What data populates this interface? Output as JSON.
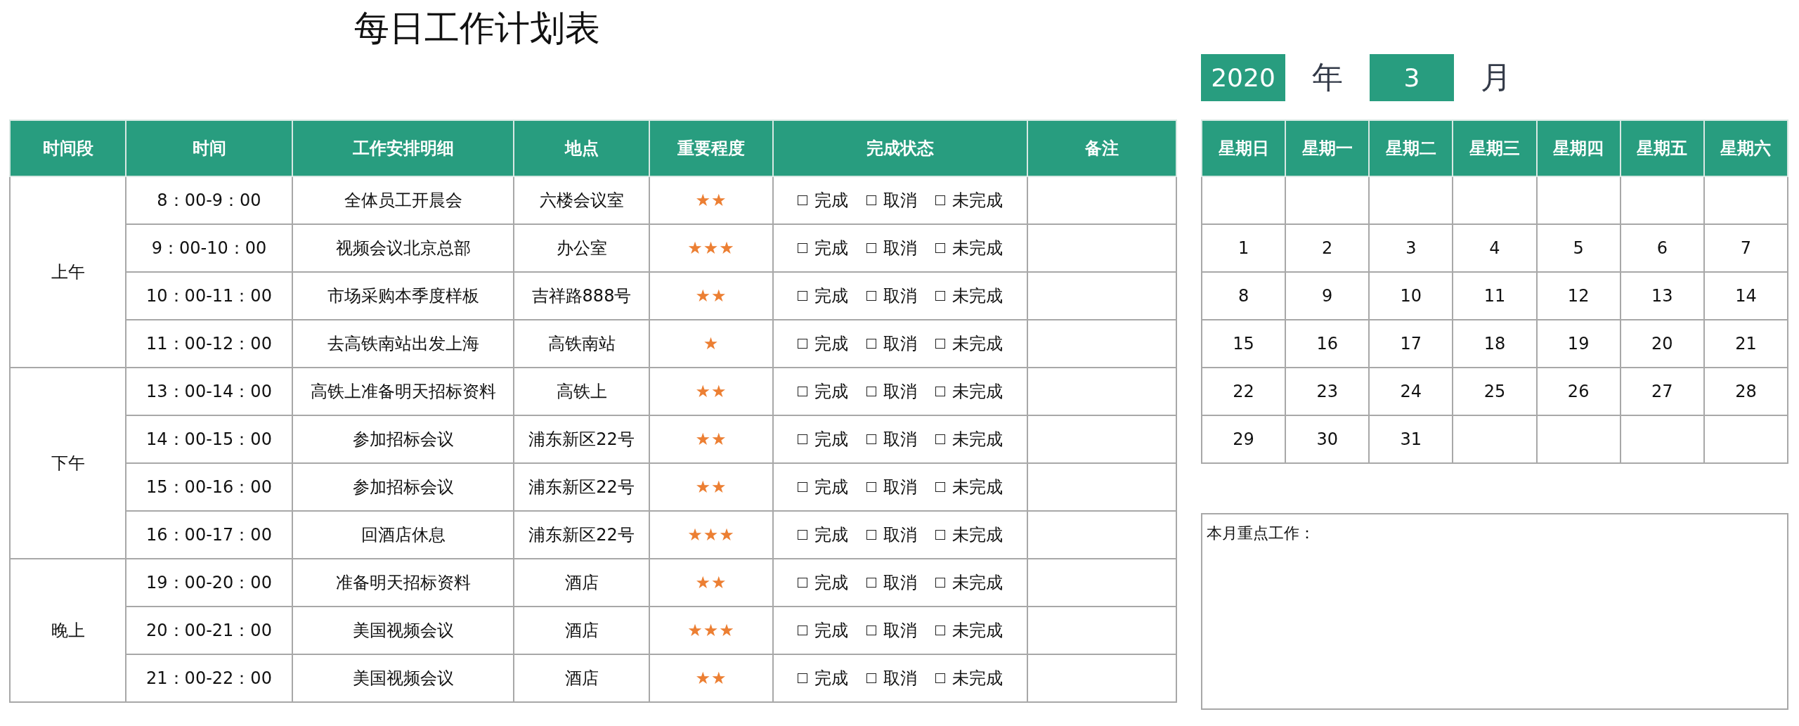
{
  "title": "每日工作计划表",
  "columns": [
    "时间段",
    "时间",
    "工作安排明细",
    "地点",
    "重要程度",
    "完成状态",
    "备注"
  ],
  "periods": [
    {
      "label": "上午",
      "slots": [
        {
          "time": "8：00-9：00",
          "task": "全体员工开晨会",
          "place": "六楼会议室",
          "importance": "★★",
          "status": [
            {
              "label": "完成",
              "checked": false
            },
            {
              "label": "取消",
              "checked": false
            },
            {
              "label": "未完成",
              "checked": false
            }
          ]
        },
        {
          "time": "9：00-10：00",
          "task": "视频会议北京总部",
          "place": "办公室",
          "importance": "★★★",
          "status": [
            {
              "label": "完成",
              "checked": false
            },
            {
              "label": "取消",
              "checked": false
            },
            {
              "label": "未完成",
              "checked": false
            }
          ]
        },
        {
          "time": "10：00-11：00",
          "task": "市场采购本季度样板",
          "place": "吉祥路888号",
          "importance": "★★",
          "status": [
            {
              "label": "完成",
              "checked": false
            },
            {
              "label": "取消",
              "checked": false
            },
            {
              "label": "未完成",
              "checked": false
            }
          ]
        },
        {
          "time": "11：00-12：00",
          "task": "去高铁南站出发上海",
          "place": "高铁南站",
          "importance": "★",
          "status": [
            {
              "label": "完成",
              "checked": false
            },
            {
              "label": "取消",
              "checked": false
            },
            {
              "label": "未完成",
              "checked": false
            }
          ]
        }
      ]
    },
    {
      "label": "下午",
      "slots": [
        {
          "time": "13：00-14：00",
          "task": "高铁上准备明天招标资料",
          "place": "高铁上",
          "importance": "★★",
          "status": [
            {
              "label": "完成",
              "checked": false
            },
            {
              "label": "取消",
              "checked": false
            },
            {
              "label": "未完成",
              "checked": false
            }
          ]
        },
        {
          "time": "14：00-15：00",
          "task": "参加招标会议",
          "place": "浦东新区22号",
          "importance": "★★",
          "status": [
            {
              "label": "完成",
              "checked": false
            },
            {
              "label": "取消",
              "checked": false
            },
            {
              "label": "未完成",
              "checked": false
            }
          ]
        },
        {
          "time": "15：00-16：00",
          "task": "参加招标会议",
          "place": "浦东新区22号",
          "importance": "★★",
          "status": [
            {
              "label": "完成",
              "checked": false
            },
            {
              "label": "取消",
              "checked": false
            },
            {
              "label": "未完成",
              "checked": false
            }
          ]
        },
        {
          "time": "16：00-17：00",
          "task": "回酒店休息",
          "place": "浦东新区22号",
          "importance": "★★★",
          "status": [
            {
              "label": "完成",
              "checked": false
            },
            {
              "label": "取消",
              "checked": false
            },
            {
              "label": "未完成",
              "checked": false
            }
          ]
        }
      ]
    },
    {
      "label": "晚上",
      "slots": [
        {
          "time": "19：00-20：00",
          "task": "准备明天招标资料",
          "place": "酒店",
          "importance": "★★",
          "status": [
            {
              "label": "完成",
              "checked": false
            },
            {
              "label": "取消",
              "checked": false
            },
            {
              "label": "未完成",
              "checked": false
            }
          ]
        },
        {
          "time": "20：00-21：00",
          "task": "美国视频会议",
          "place": "酒店",
          "importance": "★★★",
          "status": [
            {
              "label": "完成",
              "checked": false
            },
            {
              "label": "取消",
              "checked": false
            },
            {
              "label": "未完成",
              "checked": false
            }
          ]
        },
        {
          "time": "21：00-22：00",
          "task": "美国视频会议",
          "place": "酒店",
          "importance": "★★",
          "status": [
            {
              "label": "完成",
              "checked": false
            },
            {
              "label": "取消",
              "checked": false
            },
            {
              "label": "未完成",
              "checked": false
            }
          ]
        }
      ]
    }
  ],
  "calendar": {
    "year": "2020",
    "year_unit": "年",
    "month": "3",
    "month_unit": "月",
    "weekdays": [
      "星期日",
      "星期一",
      "星期二",
      "星期三",
      "星期四",
      "星期五",
      "星期六"
    ],
    "weeks": [
      [
        "1",
        "2",
        "3",
        "4",
        "5",
        "6",
        "7"
      ],
      [
        "8",
        "9",
        "10",
        "11",
        "12",
        "13",
        "14"
      ],
      [
        "15",
        "16",
        "17",
        "18",
        "19",
        "20",
        "21"
      ],
      [
        "22",
        "23",
        "24",
        "25",
        "26",
        "27",
        "28"
      ],
      [
        "29",
        "30",
        "31"
      ]
    ]
  },
  "notes": {
    "label": "本月重点工作："
  }
}
